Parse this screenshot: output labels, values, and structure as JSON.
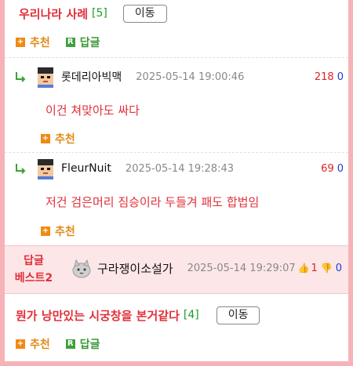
{
  "post1": {
    "title": "우리나라 사례",
    "count": "[5]",
    "move_label": "이동",
    "recommend_label": "추천",
    "reply_label": "답글"
  },
  "replies": [
    {
      "nick": "롯데리아빅맥",
      "date": "2025-05-14 19:00:46",
      "up": "218",
      "down": "0",
      "content": "이건 쳐맞아도 싸다",
      "recommend_label": "추천"
    },
    {
      "nick": "FleurNuit",
      "date": "2025-05-14 19:28:43",
      "up": "69",
      "down": "0",
      "content": "저건 검은머리 짐승이라 두들겨 패도 합법임",
      "recommend_label": "추천"
    }
  ],
  "best": {
    "label_line1": "답글",
    "label_line2": "베스트2",
    "nick": "구라쟁이소설가",
    "date": "2025-05-14 19:29:07",
    "up": "1",
    "down": "0"
  },
  "post2": {
    "title": "뭔가 낭만있는 시궁창을 본거같다",
    "count": "[4]",
    "move_label": "이동",
    "recommend_label": "추천",
    "reply_label": "답글"
  },
  "colors": {
    "accent_red": "#e0303a",
    "count_green": "#1e9c2a",
    "border_pink": "#f5b3b8",
    "best_bg": "#fde6e8"
  },
  "icons": {
    "reply": "reply-arrow-icon",
    "plus": "plus-icon",
    "reply_badge": "reply-badge-icon",
    "avatar_pixel": "pixel-avatar-icon",
    "avatar_cat": "cat-avatar-icon",
    "thumb_up": "thumbs-up-icon",
    "thumb_down": "thumbs-down-icon"
  }
}
